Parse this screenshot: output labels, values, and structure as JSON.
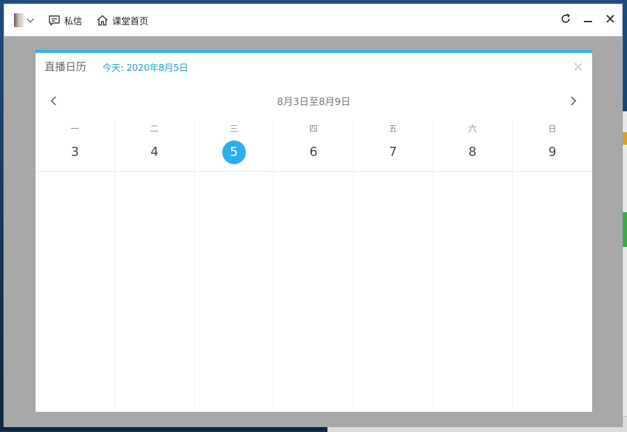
{
  "titlebar": {
    "messages_label": "私信",
    "home_label": "课堂首页"
  },
  "modal": {
    "title": "直播日历",
    "today": "今天: 2020年8月5日",
    "week_range": "8月3日至8月9日",
    "days": [
      {
        "weekday": "一",
        "date": "3",
        "today": false
      },
      {
        "weekday": "二",
        "date": "4",
        "today": false
      },
      {
        "weekday": "三",
        "date": "5",
        "today": true
      },
      {
        "weekday": "四",
        "date": "6",
        "today": false
      },
      {
        "weekday": "五",
        "date": "7",
        "today": false
      },
      {
        "weekday": "六",
        "date": "8",
        "today": false
      },
      {
        "weekday": "日",
        "date": "9",
        "today": false
      }
    ]
  },
  "colors": {
    "accent": "#2aaef0",
    "today_text": "#1f9fd8",
    "overlay": "#a8a8a8"
  },
  "icons": {
    "avatar": "avatar",
    "messages": "message-icon",
    "home": "home-icon",
    "refresh": "refresh-icon",
    "minimize": "minimize-icon",
    "close": "close-icon",
    "prev": "chevron-left-icon",
    "next": "chevron-right-icon"
  }
}
